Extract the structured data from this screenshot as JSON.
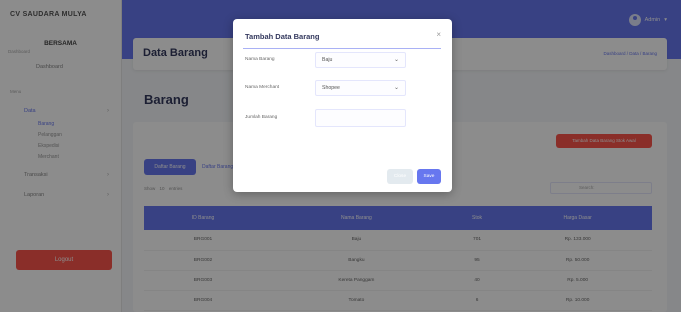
{
  "brand": {
    "name": "CV SAUDARA MULYA",
    "subtitle": "BERSAMA",
    "sub2": "Dashboard"
  },
  "sidebar": {
    "dashboard": "Dashboard",
    "section_menu": "Menu",
    "items": [
      {
        "label": "Data",
        "active": true
      },
      {
        "label": "Transaksi"
      },
      {
        "label": "Laporan"
      }
    ],
    "subitems": [
      {
        "label": "Barang",
        "active": true
      },
      {
        "label": "Pelanggan"
      },
      {
        "label": "Ekspedisi"
      },
      {
        "label": "Merchant"
      }
    ],
    "logout": "Logout"
  },
  "navbar": {
    "user": "Admin"
  },
  "header": {
    "title": "Data Barang",
    "breadcrumb": "Dashboard / Data / Barang"
  },
  "section": {
    "title": "Barang"
  },
  "main": {
    "add_button": "Tambah Data Barang Stok Awal",
    "tabs": [
      "Daftar Barang",
      "Daftar Barang"
    ],
    "show_label": "Show",
    "show_value": "10",
    "entries_label": "entries",
    "search_label": "Search:"
  },
  "table": {
    "headers": [
      "ID Barang",
      "Nama Barang",
      "Stok",
      "Harga Dasar"
    ],
    "rows": [
      [
        "BRG001",
        "Baju",
        "701",
        "Rp. 133.000"
      ],
      [
        "BRG002",
        "Bangku",
        "95",
        "Rp. 50.000"
      ],
      [
        "BRG003",
        "Kereta Panggam",
        "40",
        "Rp. 5.000"
      ],
      [
        "BRG004",
        "Tomato",
        "6",
        "Rp. 10.000"
      ]
    ]
  },
  "modal": {
    "title": "Tambah Data Barang",
    "close_icon": "×",
    "fields": [
      {
        "label": "Nama Barang",
        "value": "Baju",
        "type": "select"
      },
      {
        "label": "Nama Merchant",
        "value": "Shopee",
        "type": "select"
      },
      {
        "label": "Jumlah Barang",
        "value": "",
        "type": "input"
      }
    ],
    "close_button": "Close",
    "save_button": "Save"
  },
  "colors": {
    "primary": "#6777ef",
    "danger": "#fc544b",
    "overlay": "rgba(0,0,0,0.45)"
  }
}
